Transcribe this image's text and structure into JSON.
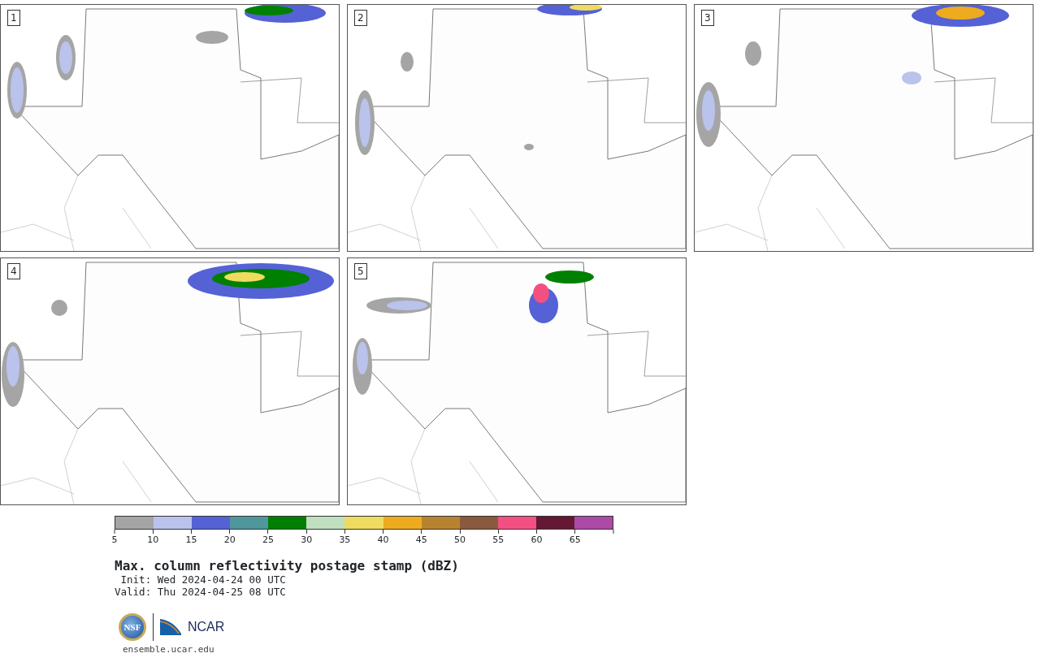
{
  "panels": [
    {
      "label": "1"
    },
    {
      "label": "2"
    },
    {
      "label": "3"
    },
    {
      "label": "4"
    },
    {
      "label": "5"
    }
  ],
  "colorbar": {
    "bins": [
      {
        "color": "#a5a5a5"
      },
      {
        "color": "#b9c3ec"
      },
      {
        "color": "#5462d6"
      },
      {
        "color": "#4f979c"
      },
      {
        "color": "#008000"
      },
      {
        "color": "#bfdfbf"
      },
      {
        "color": "#efdb5f"
      },
      {
        "color": "#efab1e"
      },
      {
        "color": "#b88331"
      },
      {
        "color": "#8b5a3e"
      },
      {
        "color": "#f25083"
      },
      {
        "color": "#641834"
      },
      {
        "color": "#ad4aa6"
      }
    ],
    "tick_labels": [
      "5",
      "10",
      "15",
      "20",
      "25",
      "30",
      "35",
      "40",
      "45",
      "50",
      "55",
      "60",
      "65"
    ]
  },
  "title": "Max. column reflectivity postage stamp (dBZ)",
  "init": " Init: Wed 2024-04-24 00 UTC",
  "valid": "Valid: Thu 2024-04-25 08 UTC",
  "logos": {
    "seal_text": "NSF",
    "wordmark": "NCAR"
  },
  "url": "ensemble.ucar.edu"
}
